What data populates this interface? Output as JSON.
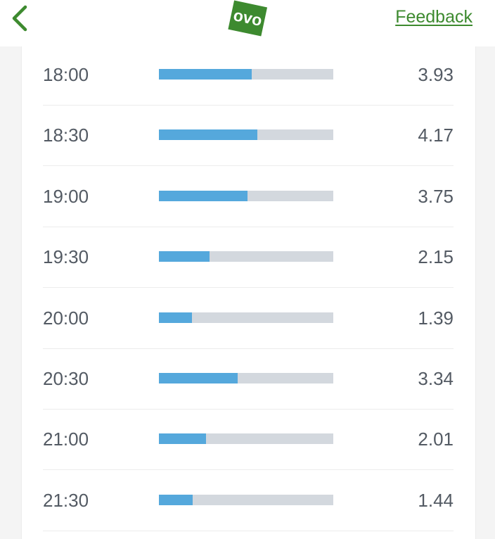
{
  "header": {
    "back_icon": "chevron-left-icon",
    "logo_text": "ovo",
    "feedback_label": "Feedback",
    "accent_color": "#3d8a2f"
  },
  "usage": {
    "bar_color": "#55a8dc",
    "track_color": "#d3d8de",
    "scale_max": 7.4,
    "rows": [
      {
        "time": "18:00",
        "value": "3.93",
        "amount": 3.93
      },
      {
        "time": "18:30",
        "value": "4.17",
        "amount": 4.17
      },
      {
        "time": "19:00",
        "value": "3.75",
        "amount": 3.75
      },
      {
        "time": "19:30",
        "value": "2.15",
        "amount": 2.15
      },
      {
        "time": "20:00",
        "value": "1.39",
        "amount": 1.39
      },
      {
        "time": "20:30",
        "value": "3.34",
        "amount": 3.34
      },
      {
        "time": "21:00",
        "value": "2.01",
        "amount": 2.01
      },
      {
        "time": "21:30",
        "value": "1.44",
        "amount": 1.44
      }
    ]
  }
}
